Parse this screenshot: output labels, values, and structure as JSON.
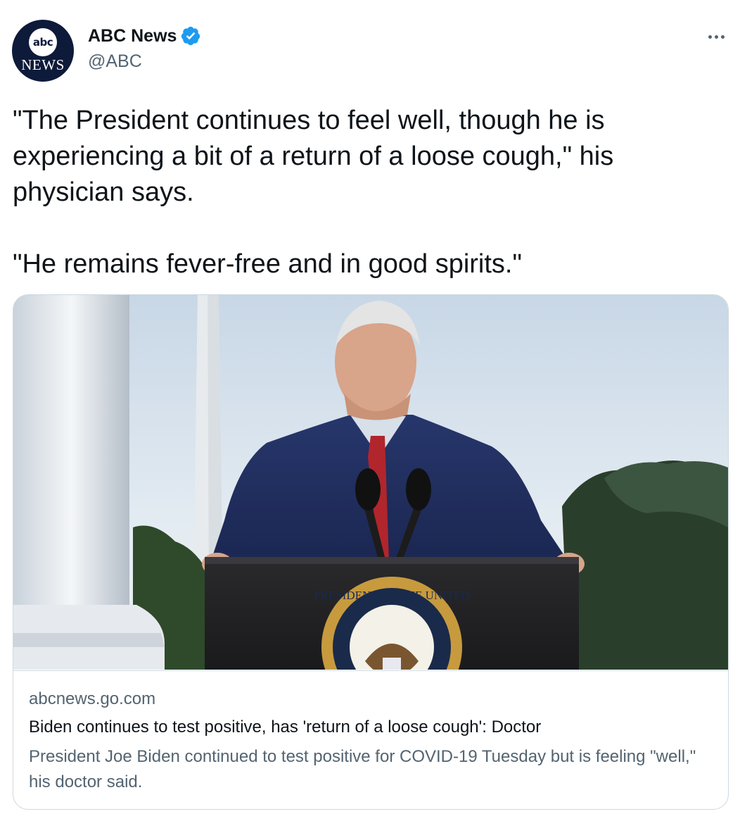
{
  "author": {
    "display_name": "ABC News",
    "handle": "@ABC",
    "verified": true,
    "avatar": {
      "logo_text": "abc",
      "logo_subtext": "NEWS",
      "background_color": "#0d1a3a"
    }
  },
  "menu": {
    "icon": "more-horizontal-icon"
  },
  "tweet": {
    "paragraphs": [
      "\"The President continues to feel well, though he is experiencing a bit of a return of a loose cough,\" his physician says.",
      "\"He remains fever-free and in good spirits.\""
    ]
  },
  "link_card": {
    "image_seal_text": "PRESIDENT OF THE UNITED",
    "domain": "abcnews.go.com",
    "title": "Biden continues to test positive, has 'return of a loose cough': Doctor",
    "description": "President Joe Biden continued to test positive for COVID-19 Tuesday but is feeling \"well,\" his doctor said."
  },
  "colors": {
    "text_primary": "#0f1419",
    "text_secondary": "#536471",
    "verified_blue": "#1d9bf0",
    "border": "#cfd9de"
  }
}
